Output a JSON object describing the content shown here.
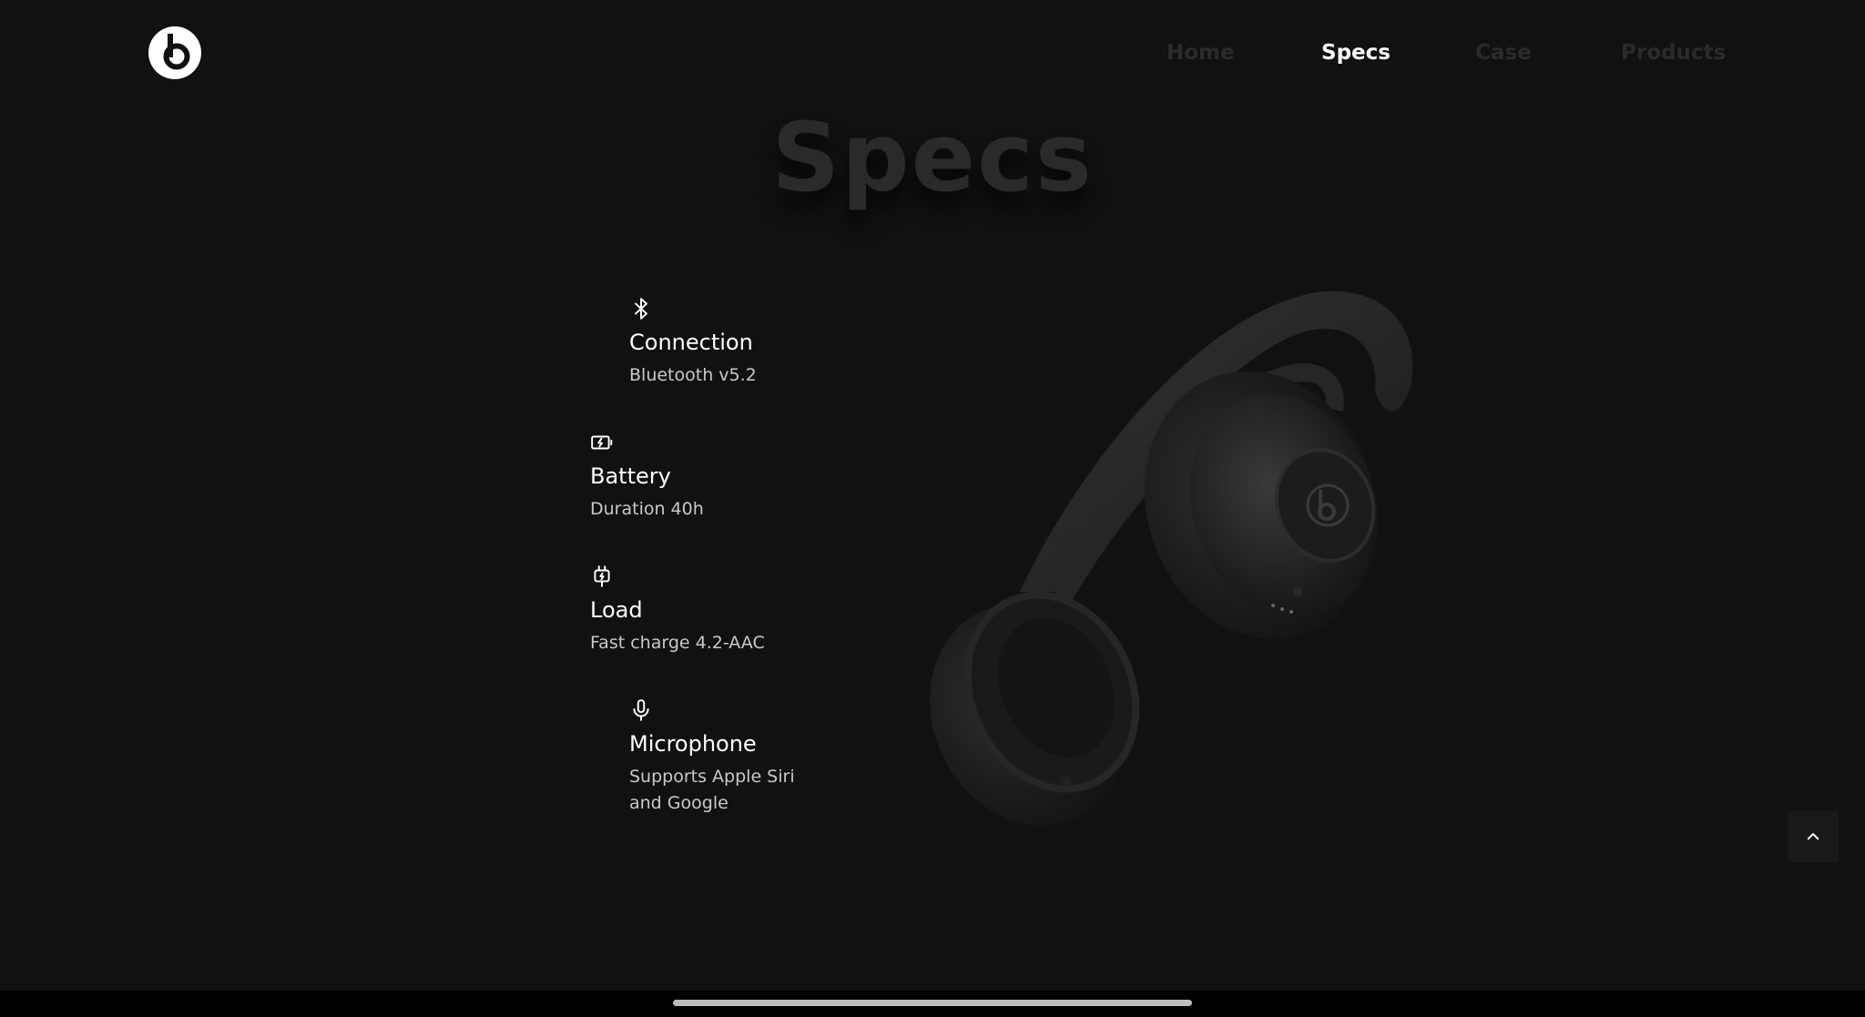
{
  "nav": {
    "home": "Home",
    "specs": "Specs",
    "case": "Case",
    "products": "Products",
    "active": "Specs"
  },
  "section": {
    "title": "Specs"
  },
  "specs": [
    {
      "icon": "bluetooth-icon",
      "name": "Connection",
      "desc": "Bluetooth v5.2"
    },
    {
      "icon": "battery-charging-icon",
      "name": "Battery",
      "desc": "Duration 40h"
    },
    {
      "icon": "plug-icon",
      "name": "Load",
      "desc": "Fast charge 4.2-AAC"
    },
    {
      "icon": "microphone-icon",
      "name": "Microphone",
      "desc": "Supports Apple Siri and Google"
    }
  ],
  "colors": {
    "background": "#111111",
    "nav_inactive": "#2b2b2b",
    "nav_active": "#ffffff",
    "title": "#2a2a2a",
    "desc": "#c9c9c9"
  }
}
